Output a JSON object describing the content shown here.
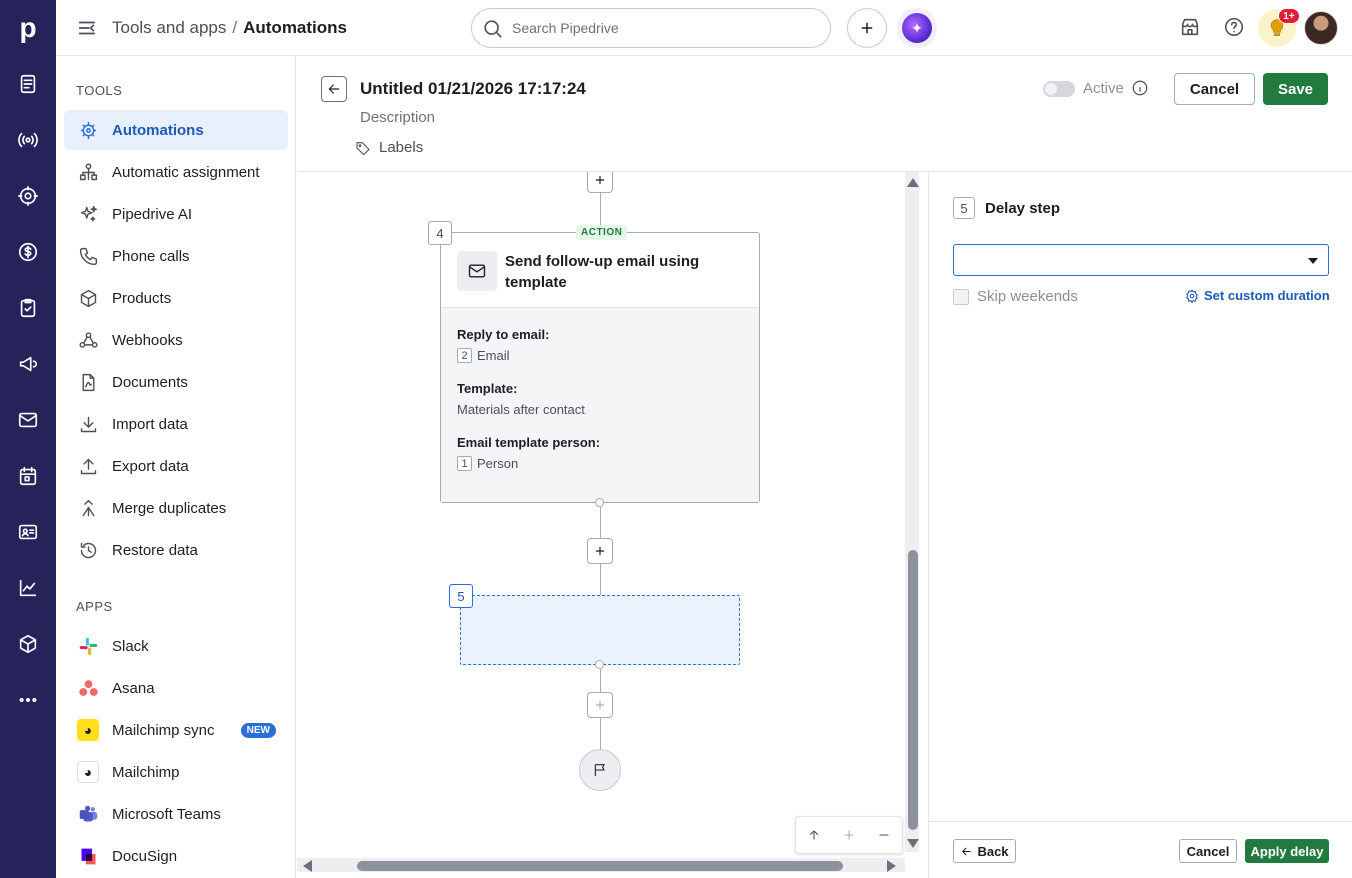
{
  "app": {
    "logo_letter": "p"
  },
  "topbar": {
    "breadcrumb": {
      "parent": "Tools and apps",
      "separator": "/",
      "current": "Automations"
    },
    "search_placeholder": "Search Pipedrive",
    "notifications_badge": "1+"
  },
  "sidenav": {
    "tools_title": "TOOLS",
    "tools": [
      {
        "label": "Automations",
        "icon": "automations-icon",
        "active": true
      },
      {
        "label": "Automatic assignment",
        "icon": "assignment-icon"
      },
      {
        "label": "Pipedrive AI",
        "icon": "sparkle-icon"
      },
      {
        "label": "Phone calls",
        "icon": "phone-icon"
      },
      {
        "label": "Products",
        "icon": "box-icon"
      },
      {
        "label": "Webhooks",
        "icon": "webhook-icon"
      },
      {
        "label": "Documents",
        "icon": "document-icon"
      },
      {
        "label": "Import data",
        "icon": "download-icon"
      },
      {
        "label": "Export data",
        "icon": "upload-icon"
      },
      {
        "label": "Merge duplicates",
        "icon": "merge-icon"
      },
      {
        "label": "Restore data",
        "icon": "restore-icon"
      }
    ],
    "apps_title": "APPS",
    "apps": [
      {
        "label": "Slack",
        "icon": "slack-icon"
      },
      {
        "label": "Asana",
        "icon": "asana-icon"
      },
      {
        "label": "Mailchimp sync",
        "icon": "mailchimp-icon",
        "badge": "NEW"
      },
      {
        "label": "Mailchimp",
        "icon": "mailchimp-icon"
      },
      {
        "label": "Microsoft Teams",
        "icon": "teams-icon"
      },
      {
        "label": "DocuSign",
        "icon": "docusign-icon"
      }
    ]
  },
  "editor": {
    "title": "Untitled 01/21/2026 17:17:24",
    "description_placeholder": "Description",
    "labels_label": "Labels",
    "active_label": "Active",
    "active": false,
    "cancel_label": "Cancel",
    "save_label": "Save"
  },
  "canvas": {
    "step4": {
      "number": "4",
      "tag": "ACTION",
      "title": "Send follow-up email using template",
      "fields": [
        {
          "label": "Reply to email:",
          "chip": "2",
          "value": "Email"
        },
        {
          "label": "Template:",
          "chip": "",
          "value": "Materials after contact"
        },
        {
          "label": "Email template person:",
          "chip": "1",
          "value": "Person"
        }
      ]
    },
    "step5": {
      "number": "5"
    }
  },
  "panel": {
    "step_number": "5",
    "title": "Delay step",
    "select_value": "",
    "skip_weekends_label": "Skip weekends",
    "custom_duration_label": "Set custom duration",
    "back_label": "Back",
    "cancel_label": "Cancel",
    "apply_label": "Apply delay"
  },
  "colors": {
    "rail": "#26235a",
    "accent": "#2b6fd6",
    "save_green": "#237a3f",
    "active_bg": "#e7f0fc"
  }
}
